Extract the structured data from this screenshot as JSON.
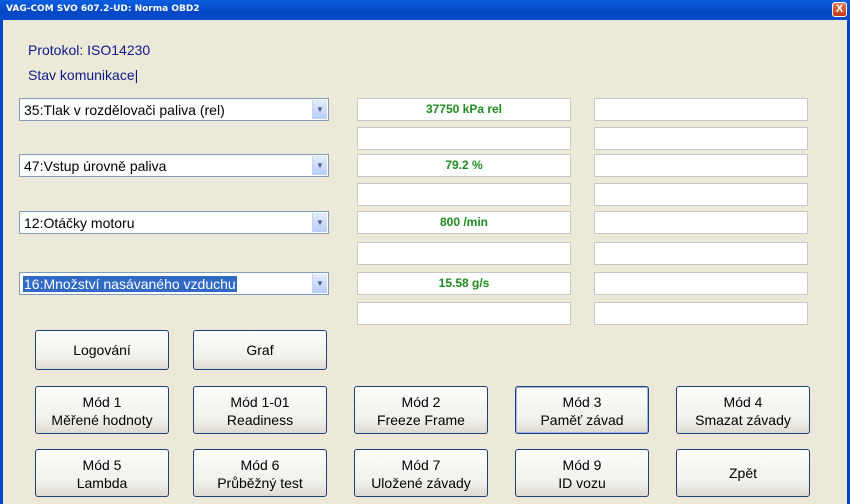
{
  "window": {
    "title": "VAG-COM SVO 607.2-UD:  Norma OBD2",
    "close_label": "X"
  },
  "info": {
    "protocol": "Protokol: ISO14230",
    "status": "Stav komunikace|"
  },
  "rows": [
    {
      "param": "35:Tlak v rozdělovači paliva (rel)",
      "value": "37750 kPa rel"
    },
    {
      "param": "47:Vstup úrovně paliva",
      "value": "79.2 %"
    },
    {
      "param": "12:Otáčky motoru",
      "value": "800 /min"
    },
    {
      "param": "16:Množství nasávaného vzduchu",
      "value": "15.58 g/s"
    }
  ],
  "actions": {
    "logging": "Logování",
    "graph": "Graf"
  },
  "modes": [
    {
      "line1": "Mód 1",
      "line2": "Měřené hodnoty"
    },
    {
      "line1": "Mód 1-01",
      "line2": "Readiness"
    },
    {
      "line1": "Mód 2",
      "line2": "Freeze Frame"
    },
    {
      "line1": "Mód 3",
      "line2": "Paměť závad"
    },
    {
      "line1": "Mód 4",
      "line2": "Smazat závady"
    },
    {
      "line1": "Mód 5",
      "line2": "Lambda"
    },
    {
      "line1": "Mód 6",
      "line2": "Průběžný test"
    },
    {
      "line1": "Mód 7",
      "line2": "Uložené závady"
    },
    {
      "line1": "Mód 9",
      "line2": "ID vozu"
    }
  ],
  "back_label": "Zpět",
  "icons": {
    "dropdown_arrow": "chevron-down-icon"
  }
}
